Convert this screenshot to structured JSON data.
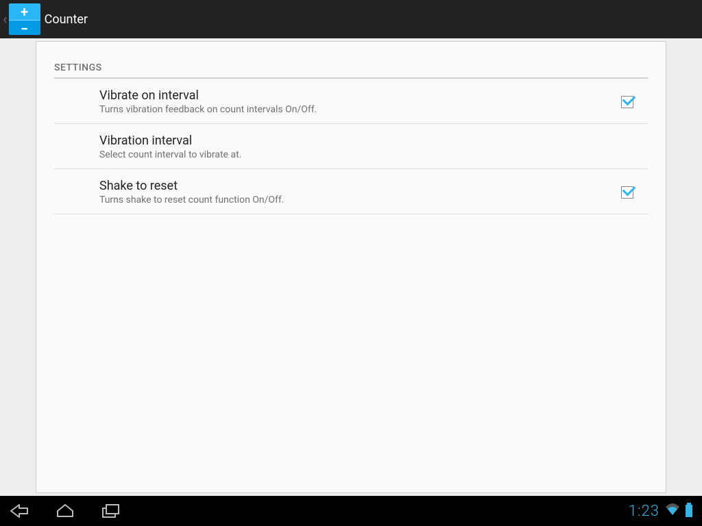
{
  "header": {
    "app_title": "Counter"
  },
  "settings": {
    "section_label": "SETTINGS",
    "items": [
      {
        "title": "Vibrate on interval",
        "subtitle": "Turns vibration feedback on count intervals On/Off.",
        "has_checkbox": true,
        "checked": true
      },
      {
        "title": "Vibration interval",
        "subtitle": "Select count interval to vibrate at.",
        "has_checkbox": false,
        "checked": false
      },
      {
        "title": "Shake to reset",
        "subtitle": "Turns shake to reset count function On/Off.",
        "has_checkbox": true,
        "checked": true
      }
    ]
  },
  "statusbar": {
    "clock": "1:23"
  }
}
